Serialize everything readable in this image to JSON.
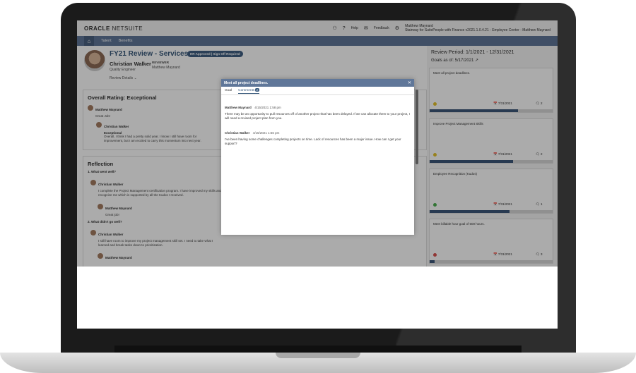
{
  "topbar": {
    "logo_main": "ORACLE",
    "logo_sub": "NETSUITE",
    "help_label": "Help",
    "feedback_label": "Feedback",
    "user_name": "Matthew Maynard",
    "user_context": "Stairway for SuitePeople with Finance v2021.1.0.4.21 - Employee Center - Matthew Maynard"
  },
  "nav": {
    "items": [
      "Talent",
      "Benefits"
    ]
  },
  "review": {
    "title": "FY21 Review - Services",
    "badge": "HR Approved | Sign Off Required",
    "employee_name": "Christian Walker",
    "employee_role": "Quality Engineer",
    "reviews_label": "REVIEWER",
    "reviewer_name": "Matthew Maynard",
    "details_label": "Review Details"
  },
  "overall_rating": {
    "heading": "Overall Rating: Exceptional",
    "comments": [
      {
        "author": "Matthew Maynard",
        "text": "Great Job!"
      },
      {
        "author": "Christian Walker",
        "rating": "Exceptional",
        "text": "Overall, I think I had a pretty solid year. I know I still have room for improvement, but I am excited to carry this momentum into next year."
      }
    ]
  },
  "reflection": {
    "heading": "Reflection",
    "q1": "1. What went well?",
    "q1_a1_author": "Christian Walker",
    "q1_a1_text": "I complete the Project Management certification program. I have improved my skills and recognize me which is supported by all the Kudos I received.",
    "q1_a2_author": "Matthew Maynard",
    "q1_a2_text": "Great job!",
    "q2": "2. What didn't go well?",
    "q2_a1_author": "Christian Walker",
    "q2_a1_text": "I still have room to improve my project management skill set. I need to take what I learned and break tasks down to prioritization.",
    "q2_a2_author": "Matthew Maynard"
  },
  "goals_panel": {
    "period": "Review Period: 1/1/2021 - 12/31/2021",
    "goals_as_of": "Goals as of: 5/17/2021",
    "goals": [
      {
        "title": "Meet all project deadlines.",
        "date": "7/31/2021",
        "count": "2",
        "status_color": "#e3c12b",
        "progress": 0.72
      },
      {
        "title": "Improve Project Management Skills",
        "date": "7/31/2021",
        "count": "2",
        "status_color": "#e3c12b",
        "progress": 0.68
      },
      {
        "title": "Employee Recognition (Kudos)",
        "date": "7/31/2021",
        "count": "1",
        "status_color": "#4caf50",
        "progress": 0.65
      },
      {
        "title": "Meet billable hour goal of 500 hours.",
        "date": "7/31/2021",
        "count": "3",
        "status_color": "#d9534f",
        "progress": 0.04
      }
    ]
  },
  "modal": {
    "title": "Meet all project deadlines.",
    "close_label": "✕",
    "tab_goal": "Goal",
    "tab_comments": "Comments",
    "comments_count": "2",
    "comments": [
      {
        "author": "Matthew Maynard",
        "time": "4/15/2021 1:58 pm",
        "text": "There may be an opportunity to pull resources off of another project that has been delayed. If we can allocate them to your project, I will need a revised project plan from you."
      },
      {
        "author": "Christian Walker",
        "time": "4/15/2021 1:56 pm",
        "text": "I've been having some challenges completing projects on time. Lack of resources has been a major issue. How can I get your support?"
      }
    ]
  }
}
